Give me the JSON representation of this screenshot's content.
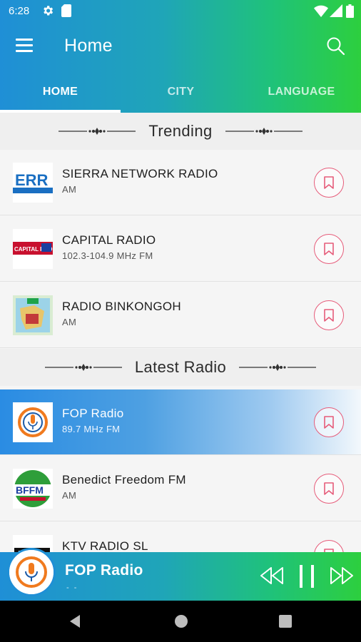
{
  "status_bar": {
    "time": "6:28"
  },
  "app_bar": {
    "title": "Home"
  },
  "tabs": [
    {
      "label": "HOME",
      "active": true
    },
    {
      "label": "CITY",
      "active": false
    },
    {
      "label": "LANGUAGE",
      "active": false
    }
  ],
  "sections": {
    "trending": "Trending",
    "latest": "Latest Radio"
  },
  "trending": [
    {
      "name": "SIERRA NETWORK RADIO",
      "freq": "AM",
      "logo_text": "ERR"
    },
    {
      "name": "CAPITAL RADIO",
      "freq": "102.3-104.9 MHz FM",
      "logo_text": "CAPITAL RADIO"
    },
    {
      "name": "RADIO BINKONGOH",
      "freq": "AM",
      "logo_text": ""
    }
  ],
  "latest": [
    {
      "name": "FOP Radio",
      "freq": "89.7 MHz FM",
      "playing": true
    },
    {
      "name": "Benedict Freedom FM",
      "freq": "AM",
      "logo_text": "BFFM"
    },
    {
      "name": "KTV RADIO SL",
      "freq": ""
    }
  ],
  "player": {
    "title": "FOP Radio",
    "subtitle": "- -"
  },
  "colors": {
    "accent_blue": "#1f8fd6",
    "accent_green": "#2dcf3e",
    "bookmark": "#e65c7a"
  }
}
